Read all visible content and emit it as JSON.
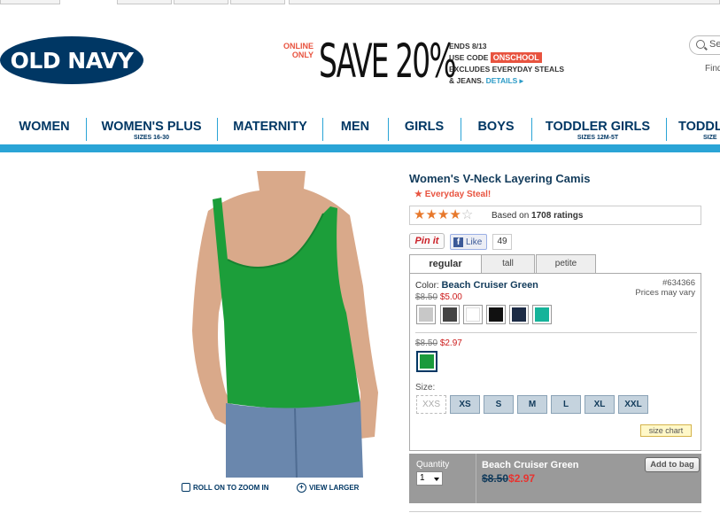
{
  "logo": {
    "text": "OLD NAVY"
  },
  "promo": {
    "online_only": "ONLINE ONLY",
    "headline": "SAVE 20%",
    "ends": "ENDS 8/13",
    "use_code": "USE CODE",
    "code": "ONSCHOOL",
    "excludes": "EXCLUDES EVERYDAY STEALS",
    "jeans": "& JEANS.",
    "details": "DETAILS ▸"
  },
  "search": {
    "placeholder": "Se"
  },
  "find": "Find",
  "nav": {
    "items": [
      {
        "label": "WOMEN",
        "sub": ""
      },
      {
        "label": "WOMEN'S PLUS",
        "sub": "SIZES 16-30"
      },
      {
        "label": "MATERNITY",
        "sub": ""
      },
      {
        "label": "MEN",
        "sub": ""
      },
      {
        "label": "GIRLS",
        "sub": ""
      },
      {
        "label": "BOYS",
        "sub": ""
      },
      {
        "label": "TODDLER GIRLS",
        "sub": "SIZES 12M-5T"
      },
      {
        "label": "TODDL",
        "sub": "SIZE"
      }
    ]
  },
  "product": {
    "title": "Women's V-Neck Layering Camis",
    "badge": "★ Everyday Steal!",
    "rating": {
      "stars": 4,
      "max": 5,
      "based_on": "Based on",
      "count": "1708 ratings"
    },
    "pinit": "Pin it",
    "fb_like": "Like",
    "fb_count": "49",
    "tabs": [
      "regular",
      "tall",
      "petite"
    ],
    "active_tab": "regular",
    "color_label": "Color:",
    "color_name": "Beach Cruiser Green",
    "sku": "#634366",
    "prices_vary": "Prices may vary",
    "group1": {
      "original": "$8.50",
      "sale": "$5.00"
    },
    "group1_swatches": [
      "#c8c8c8",
      "#444444",
      "#ffffff",
      "#111111",
      "#1c2b45",
      "#16b39a"
    ],
    "group2": {
      "original": "$8.50",
      "sale": "$2.97"
    },
    "group2_swatch": "#1a9a3c",
    "size_label": "Size:",
    "sizes": [
      "XXS",
      "XS",
      "S",
      "M",
      "L",
      "XL",
      "XXL"
    ],
    "unavailable_sizes": [
      "XXS"
    ],
    "size_chart": "size chart",
    "zoom_text": "ROLL ON TO ZOOM IN",
    "view_larger": "VIEW LARGER"
  },
  "bag": {
    "quantity_label": "Quantity",
    "quantity_value": "1",
    "color_name": "Beach Cruiser Green",
    "original": "$8.50",
    "sale": "$2.97",
    "add_button": "Add to bag"
  }
}
